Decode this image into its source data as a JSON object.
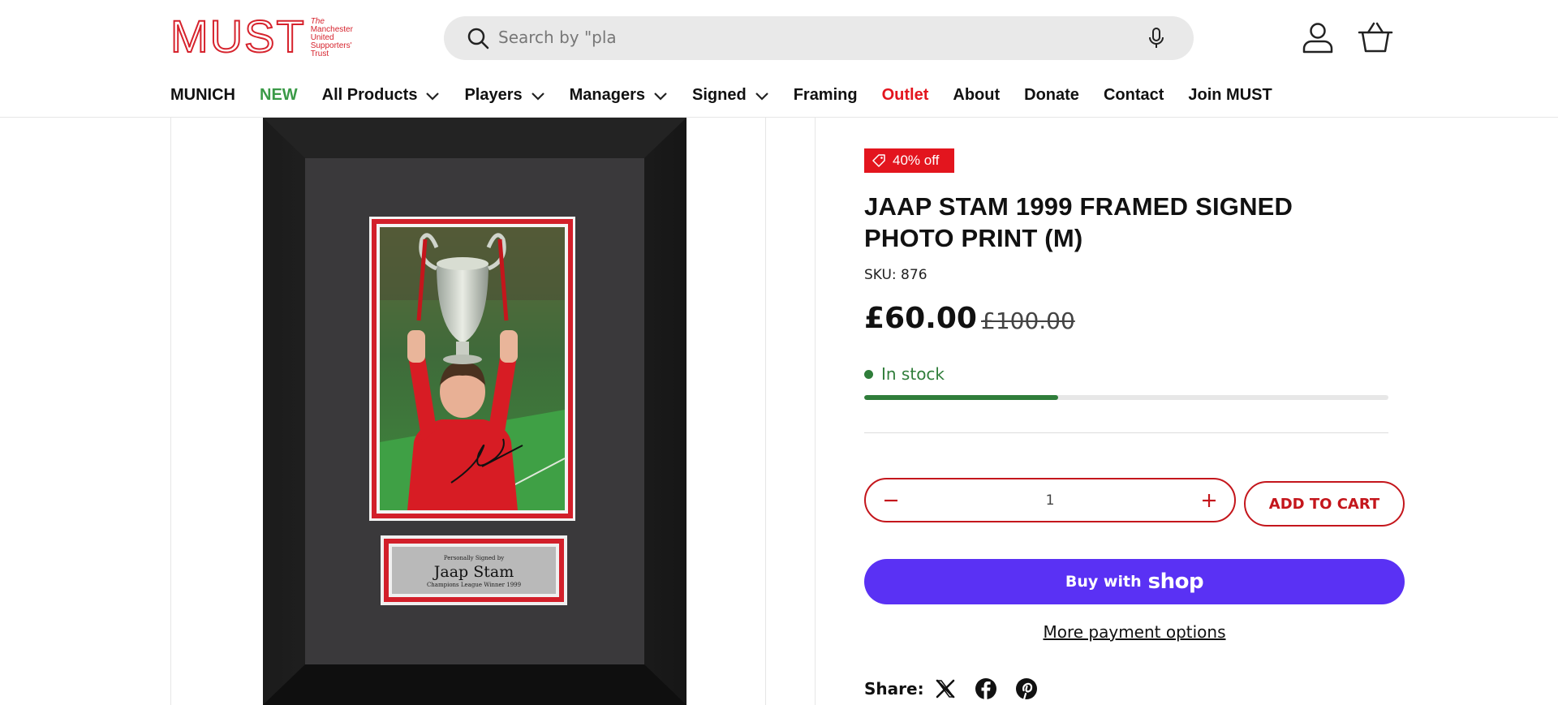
{
  "header": {
    "logo": {
      "letters": [
        "M",
        "U",
        "S",
        "T"
      ],
      "subtitle": [
        "The",
        "Manchester",
        "United",
        "Supporters'",
        "Trust"
      ]
    },
    "search": {
      "placeholder": "Search by \"pla"
    },
    "icons": {
      "account": "account-icon",
      "basket": "basket-icon",
      "search": "search-icon",
      "mic": "mic-icon"
    }
  },
  "nav": {
    "items": [
      {
        "label": "MUNICH",
        "dropdown": false
      },
      {
        "label": "NEW",
        "dropdown": false,
        "color": "#3a9a47"
      },
      {
        "label": "All Products",
        "dropdown": true
      },
      {
        "label": "Players",
        "dropdown": true
      },
      {
        "label": "Managers",
        "dropdown": true
      },
      {
        "label": "Signed",
        "dropdown": true
      },
      {
        "label": "Framing",
        "dropdown": false
      },
      {
        "label": "Outlet",
        "dropdown": false,
        "color": "#e3151e"
      },
      {
        "label": "About",
        "dropdown": false
      },
      {
        "label": "Donate",
        "dropdown": false
      },
      {
        "label": "Contact",
        "dropdown": false
      },
      {
        "label": "Join MUST",
        "dropdown": false
      }
    ]
  },
  "product": {
    "badge": "40% off",
    "title": "JAAP STAM 1999 FRAMED SIGNED PHOTO PRINT (M)",
    "sku": "SKU: 876",
    "price": "£60.00",
    "compare_price": "£100.00",
    "stock_text": "In stock",
    "stock_level": 0.37,
    "quantity": "1",
    "add_to_cart": "ADD TO CART",
    "buy_with": "Buy with",
    "shop_brand": "shop",
    "more_payment": "More payment options",
    "share_label": "Share:",
    "share_icons": [
      "x-icon",
      "facebook-icon",
      "pinterest-icon"
    ],
    "plaque": {
      "line1": "Personally Signed by",
      "name": "Jaap Stam",
      "line3": "Champions League Winner 1999"
    }
  },
  "colors": {
    "brand_red": "#d6232d",
    "sale_red": "#e3151e",
    "stock_green": "#2f7d3a",
    "shop_purple": "#5a31f4"
  }
}
